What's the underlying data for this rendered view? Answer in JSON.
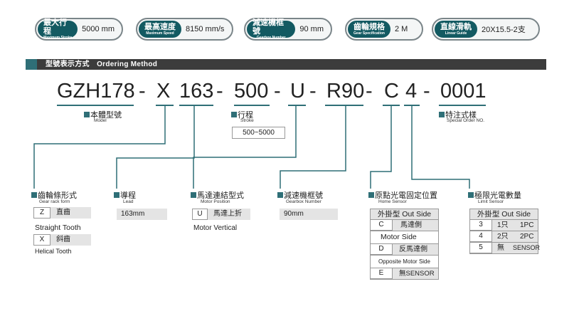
{
  "specs": [
    {
      "label_zh": "最大行程",
      "label_en": "Maximum Stroke",
      "value": "5000 mm"
    },
    {
      "label_zh": "最高速度",
      "label_en": "Maximum Speed",
      "value": "8150 mm/s"
    },
    {
      "label_zh": "減速機框號",
      "label_en": "Gearbox Number",
      "value": "90 mm"
    },
    {
      "label_zh": "齒輪規格",
      "label_en": "Gear Specification",
      "value": "2 M"
    },
    {
      "label_zh": "直線滑軌",
      "label_en": "Linear Guide",
      "value": "20X15.5-2支"
    }
  ],
  "section": {
    "title": "型號表示方式　Ordering Method"
  },
  "code": {
    "p1": "GZH178",
    "d1": "-",
    "p2": "X",
    "p3": "163",
    "d2": "-",
    "p4": "500",
    "d3": "-",
    "p5": "U",
    "d4": "-",
    "p6": "R90",
    "d5": "-",
    "p7": "C",
    "p8": "4",
    "d6": "-",
    "p9": "0001"
  },
  "model": {
    "zh": "本體型號",
    "en": "Model"
  },
  "stroke": {
    "zh": "行程",
    "en": "Stroke",
    "value": "500~5000"
  },
  "special": {
    "zh": "特注式樣",
    "en": "Special Order NO."
  },
  "gear_rack": {
    "zh": "齒輪條形式",
    "en": "Gear rack form",
    "rows": [
      {
        "code": "Z",
        "zh": "直齒",
        "en": "Straight Tooth"
      },
      {
        "code": "X",
        "zh": "斜齒",
        "en": "Helical Tooth"
      }
    ]
  },
  "lead": {
    "zh": "導程",
    "en": "Lead",
    "value": "163mm"
  },
  "motor_position": {
    "zh": "馬達連結型式",
    "en": "Motor Position",
    "code": "U",
    "value_zh": "馬達上折",
    "value_en": "Motor Vertical"
  },
  "gearbox": {
    "zh": "減速機框號",
    "en": "Gearbox Number",
    "value": "90mm"
  },
  "home_sensor": {
    "zh": "原點光電固定位置",
    "en": "Home Sensor",
    "header": "外掛型 Out Side",
    "rows": [
      {
        "code": "C",
        "zh": "馬達側",
        "en": "Motor Side"
      },
      {
        "code": "D",
        "zh": "反馬達側",
        "en": "Opposite Motor Side"
      },
      {
        "code": "E",
        "zh": "無SENSOR",
        "en": ""
      }
    ]
  },
  "limit_sensor": {
    "zh": "極限光電數量",
    "en": "Limit Sensor",
    "header": "外掛型 Out Side",
    "rows": [
      {
        "code": "3",
        "zh": "1只",
        "en": "1PC"
      },
      {
        "code": "4",
        "zh": "2只",
        "en": "2PC"
      },
      {
        "code": "5",
        "zh": "無",
        "en": "SENSOR"
      }
    ]
  },
  "colors": {
    "accent": "#2f6f77",
    "tag": "#135a62",
    "bar": "#3c3c3c",
    "box_bg": "#e4e4e4"
  }
}
